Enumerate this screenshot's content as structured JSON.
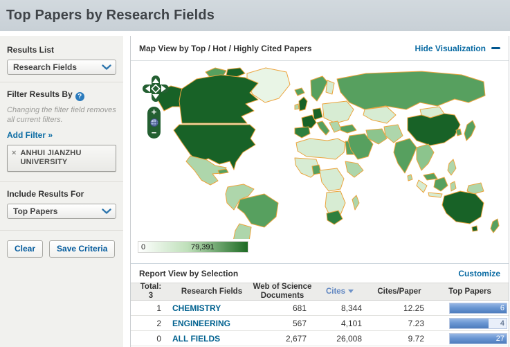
{
  "header": {
    "title": "Top Papers by Research Fields"
  },
  "sidebar": {
    "results_list_label": "Results List",
    "results_list_value": "Research Fields",
    "filter_label": "Filter Results By",
    "filter_help": "?",
    "filter_note": "Changing the filter field removes all current filters.",
    "add_filter": "Add Filter »",
    "filter_chip": {
      "remove": "×",
      "label": "ANHUI JIANZHU UNIVERSITY"
    },
    "include_label": "Include Results For",
    "include_value": "Top Papers",
    "clear_button": "Clear",
    "save_button": "Save Criteria"
  },
  "map": {
    "title": "Map View by Top / Hot / Highly Cited Papers",
    "hide_link": "Hide Visualization",
    "zoom_in": "+",
    "zoom_out": "−",
    "scale_min": "0",
    "scale_max": "79,391",
    "palette": {
      "high": "#186227",
      "mid": "#57a05f",
      "low": "#d7ecd3",
      "none": "#ffffff",
      "country_border": "#eca43d"
    }
  },
  "report": {
    "title": "Report View by Selection",
    "customize": "Customize",
    "total_label": "Total:",
    "total_value": "3",
    "columns": {
      "fields": "Research Fields",
      "documents": "Web of Science Documents",
      "cites": "Cites",
      "cites_per_paper": "Cites/Paper",
      "top_papers": "Top Papers"
    },
    "rows": [
      {
        "rank": "1",
        "field": "CHEMISTRY",
        "documents": "681",
        "cites": "8,344",
        "cites_per_paper": "12.25",
        "top_papers": "6",
        "bar_pct": 100
      },
      {
        "rank": "2",
        "field": "ENGINEERING",
        "documents": "567",
        "cites": "4,101",
        "cites_per_paper": "7.23",
        "top_papers": "4",
        "bar_pct": 68
      },
      {
        "rank": "0",
        "field": "ALL FIELDS",
        "documents": "2,677",
        "cites": "26,008",
        "cites_per_paper": "9.72",
        "top_papers": "27",
        "bar_pct": 100
      }
    ]
  }
}
